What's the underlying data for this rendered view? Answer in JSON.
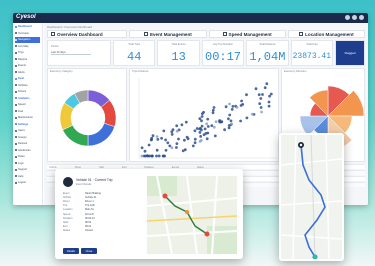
{
  "app": {
    "logo": "Cyesol"
  },
  "breadcrumb": "Dashboard / Overview Dashboard",
  "sidebar": {
    "items": [
      {
        "label": "Dashboard",
        "type": "section"
      },
      {
        "label": "Overview",
        "type": "item"
      },
      {
        "label": "Navigation",
        "type": "active"
      },
      {
        "label": "Live Map",
        "type": "item"
      },
      {
        "label": "Trips",
        "type": "item"
      },
      {
        "label": "Reports",
        "type": "item"
      },
      {
        "label": "Events",
        "type": "item"
      },
      {
        "label": "Alerts",
        "type": "item"
      },
      {
        "label": "Fleet",
        "type": "section"
      },
      {
        "label": "Vehicles",
        "type": "item"
      },
      {
        "label": "Drivers",
        "type": "item"
      },
      {
        "label": "Analytics",
        "type": "section"
      },
      {
        "label": "Speed",
        "type": "item"
      },
      {
        "label": "Fuel",
        "type": "item"
      },
      {
        "label": "Maintenance",
        "type": "item"
      },
      {
        "label": "Settings",
        "type": "section"
      },
      {
        "label": "Users",
        "type": "item"
      },
      {
        "label": "Groups",
        "type": "item"
      },
      {
        "label": "Devices",
        "type": "item"
      },
      {
        "label": "Geofences",
        "type": "item"
      },
      {
        "label": "Rules",
        "type": "item"
      },
      {
        "label": "Logs",
        "type": "item"
      },
      {
        "label": "Support",
        "type": "item"
      },
      {
        "label": "Help",
        "type": "item"
      },
      {
        "label": "Logout",
        "type": "item"
      }
    ]
  },
  "tabs": [
    {
      "label": "Overview Dashboard"
    },
    {
      "label": "Event Management"
    },
    {
      "label": "Speed Management"
    },
    {
      "label": "Location Management"
    }
  ],
  "filter": {
    "label": "Period",
    "value": "Last 30 days"
  },
  "kpis": [
    {
      "label": "Total Trips",
      "value": "44"
    },
    {
      "label": "Total Events",
      "value": "13"
    },
    {
      "label": "Avg Trip Duration",
      "value": "00:17"
    },
    {
      "label": "Total Distance",
      "value": "1,04M"
    },
    {
      "label": "Total Fuel",
      "value": "23873.41"
    }
  ],
  "flagged": {
    "label": "Flagged"
  },
  "panels": {
    "donut_title": "Events by Category",
    "scatter_title": "Trips Distance",
    "rose_title": "Events by Direction"
  },
  "table_headers": [
    "Vehicle",
    "Driver",
    "Start",
    "End",
    "Distance",
    "Events",
    "Status"
  ],
  "popup": {
    "title": "Vehicle 01 · Current Trip",
    "subtitle": "Event Details",
    "details": [
      {
        "k": "Event",
        "v": "Harsh Braking"
      },
      {
        "k": "Vehicle",
        "v": "Vehicle 01"
      },
      {
        "k": "Driver",
        "v": "Driver 1"
      },
      {
        "k": "Trip",
        "v": "Trip 1204"
      },
      {
        "k": "Location",
        "v": "Main St."
      },
      {
        "k": "Speed",
        "v": "42 km/h"
      },
      {
        "k": "Duration",
        "v": "00:04:12"
      },
      {
        "k": "Start",
        "v": "08:02"
      },
      {
        "k": "End",
        "v": "08:21"
      },
      {
        "k": "Status",
        "v": "Closed"
      }
    ],
    "buttons": [
      "Details",
      "Close"
    ]
  },
  "colors": {
    "accent": "#2f8fd8",
    "navy": "#1a2a4a",
    "donut": [
      "#7b5ed8",
      "#e4483e",
      "#3f6fd8",
      "#33a852",
      "#f0c93a",
      "#4ec7e0",
      "#a3a3a3"
    ],
    "rose": [
      "#e4483e",
      "#f08a3c",
      "#f6b26b",
      "#f3c8a0",
      "#4a7fd8",
      "#9fbce8"
    ]
  }
}
